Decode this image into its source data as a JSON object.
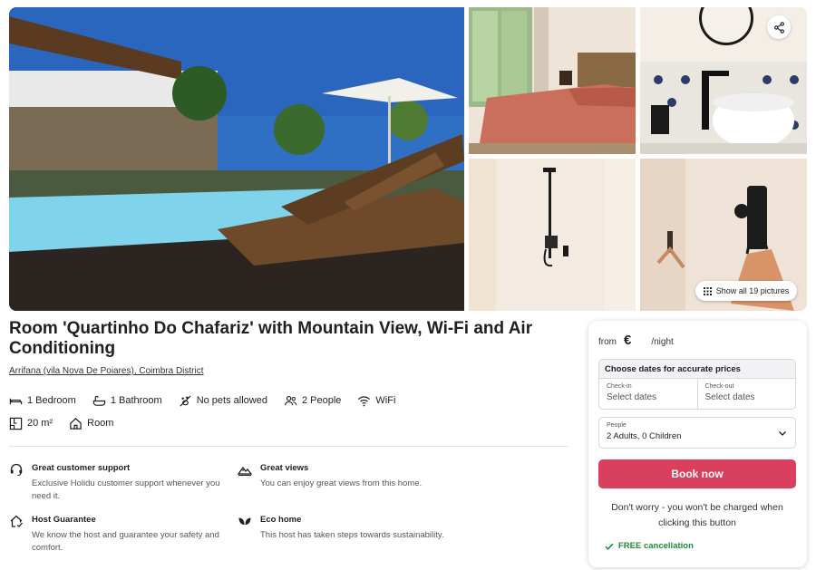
{
  "gallery": {
    "photos": [
      "pool",
      "bedroom",
      "bathtub",
      "shower",
      "coat-hook"
    ],
    "show_all_label": "Show all 19 pictures"
  },
  "listing": {
    "title": "Room 'Quartinho Do Chafariz' with Mountain View, Wi-Fi and Air Conditioning",
    "location": "Arrifana (vila Nova De Poiares), Coimbra District"
  },
  "amenities": {
    "row1": [
      {
        "icon": "bed-icon",
        "label": "1 Bedroom"
      },
      {
        "icon": "bath-icon",
        "label": "1 Bathroom"
      },
      {
        "icon": "no-pets-icon",
        "label": "No pets allowed"
      },
      {
        "icon": "people-icon",
        "label": "2 People"
      },
      {
        "icon": "wifi-icon",
        "label": "WiFi"
      }
    ],
    "row2": [
      {
        "icon": "floor-plan-icon",
        "label": "20 m²"
      },
      {
        "icon": "house-icon",
        "label": "Room"
      }
    ]
  },
  "features": [
    {
      "icon": "headset-icon",
      "title": "Great customer support",
      "desc": "Exclusive Holidu customer support whenever you need it."
    },
    {
      "icon": "mountain-icon",
      "title": "Great views",
      "desc": "You can enjoy great views from this home."
    },
    {
      "icon": "host-house-icon",
      "title": "Host Guarantee",
      "desc": "We know the host and guarantee your safety and comfort."
    },
    {
      "icon": "leaf-icon",
      "title": "Eco home",
      "desc": "This host has taken steps towards sustainability."
    }
  ],
  "booking": {
    "from_label": "from",
    "currency": "€",
    "per_night": "/night",
    "dates_heading": "Choose dates for accurate prices",
    "checkin_label": "Check-in",
    "checkin_value": "Select dates",
    "checkout_label": "Check-out",
    "checkout_value": "Select dates",
    "people_label": "People",
    "people_value": "2 Adults, 0 Children",
    "book_button": "Book now",
    "note": "Don't worry - you won't be charged when clicking this button",
    "free_cancellation": "FREE cancellation"
  },
  "colors": {
    "accent": "#d8405e",
    "success": "#1f8a3a",
    "text": "#1f1f24"
  }
}
